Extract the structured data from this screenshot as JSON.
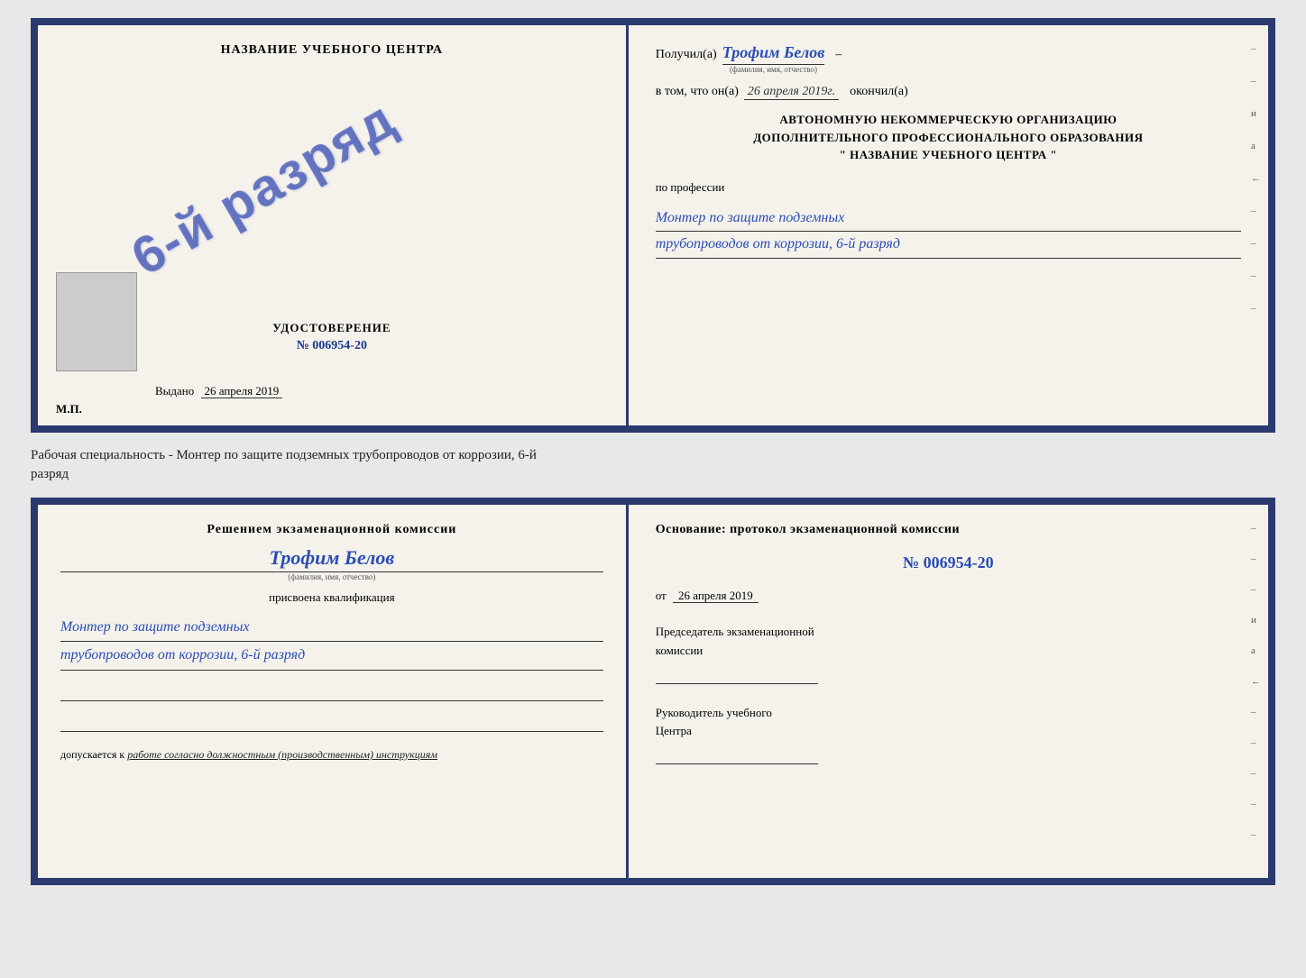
{
  "page": {
    "background_color": "#e8e8e8"
  },
  "top_cert": {
    "left": {
      "title": "НАЗВАНИЕ УЧЕБНОГО ЦЕНТРА",
      "stamp_text": "6-й разряд",
      "udostoverenie_label": "УДОСТОВЕРЕНИЕ",
      "udostoverenie_num": "№ 006954-20",
      "vydano_label": "Выдано",
      "vydano_date": "26 апреля 2019",
      "mp_label": "М.П."
    },
    "right": {
      "poluchil_label": "Получил(а)",
      "poluchil_name": "Трофим Белов",
      "fio_small": "(фамилия, имя, отчество)",
      "dash1": "–",
      "vtom_label": "в том, что он(а)",
      "vtom_date": "26 апреля 2019г.",
      "okончил_label": "окончил(а)",
      "org_line1": "АВТОНОМНУЮ НЕКОММЕРЧЕСКУЮ ОРГАНИЗАЦИЮ",
      "org_line2": "ДОПОЛНИТЕЛЬНОГО ПРОФЕССИОНАЛЬНОГО ОБРАЗОВАНИЯ",
      "org_line3": "\"   НАЗВАНИЕ УЧЕБНОГО ЦЕНТРА   \"",
      "po_professii_label": "по профессии",
      "profession_line1": "Монтер по защите подземных",
      "profession_line2": "трубопроводов от коррозии, 6-й разряд",
      "right_marks": [
        "–",
        "–",
        "и",
        "а",
        "←",
        "–",
        "–",
        "–",
        "–"
      ]
    }
  },
  "middle_text": {
    "line1": "Рабочая специальность - Монтер по защите подземных трубопроводов от коррозии, 6-й",
    "line2": "разряд"
  },
  "bottom_cert": {
    "left": {
      "resheniem_title": "Решением экзаменационной комиссии",
      "fio_name": "Трофим Белов",
      "fio_small": "(фамилия, имя, отчество)",
      "prisvoena_label": "присвоена квалификация",
      "qualification_line1": "Монтер по защите подземных",
      "qualification_line2": "трубопроводов от коррозии, 6-й разряд",
      "dopuskaetsya_label": "допускается к",
      "dopuskaetsya_value": "работе согласно должностным (производственным) инструкциям"
    },
    "right": {
      "osnovanie_label": "Основание: протокол экзаменационной комиссии",
      "protocol_num": "№ 006954-20",
      "ot_label": "от",
      "ot_date": "26 апреля 2019",
      "predsedatel_label": "Председатель экзаменационной",
      "predsedatel_label2": "комиссии",
      "rukovoditel_label": "Руководитель учебного",
      "rukovoditel_label2": "Центра",
      "right_marks": [
        "–",
        "–",
        "–",
        "и",
        "а",
        "←",
        "–",
        "–",
        "–",
        "–",
        "–"
      ]
    }
  }
}
